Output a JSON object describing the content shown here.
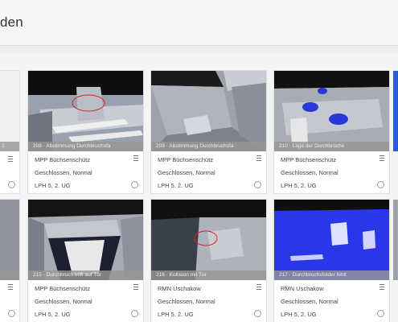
{
  "header": {
    "title": "den"
  },
  "cards": [
    {
      "caption": "2",
      "author": "",
      "status": "",
      "phase": "",
      "partial": true
    },
    {
      "caption": "208 · Abstimmung Durchbruchsfa",
      "author": "MPP Büchsenschütz",
      "status": "Geschlossen, Normal",
      "phase": "LPH 5, 2. UG"
    },
    {
      "caption": "209 · Abstimmung Durchbruchsfa",
      "author": "MPP Büchsenschütz",
      "status": "Geschlossen, Normal",
      "phase": "LPH 5, 2. UG"
    },
    {
      "caption": "210 · Lage der Durchbrüche",
      "author": "MPP Büchsenschütz",
      "status": "Geschlossen, Normal",
      "phase": "LPH 5, 2. UG"
    },
    {
      "caption": "",
      "author": "",
      "status": "",
      "phase": "",
      "partial": true
    },
    {
      "caption": "215 · Durchbruch trifft auf Tür",
      "author": "MPP Büchsenschütz",
      "status": "Geschlossen, Normal",
      "phase": "LPH 5, 2. UG"
    },
    {
      "caption": "216 · Kollision mit Tür",
      "author": "RMN Uschakow",
      "status": "Geschlossen, Normal",
      "phase": "LPH 5, 2. UG"
    },
    {
      "caption": "217 · Durchbruchsfolder fehlt",
      "author": "RMN Uschakow",
      "status": "Geschlossen, Normal",
      "phase": "LPH 5, 2. UG"
    }
  ]
}
